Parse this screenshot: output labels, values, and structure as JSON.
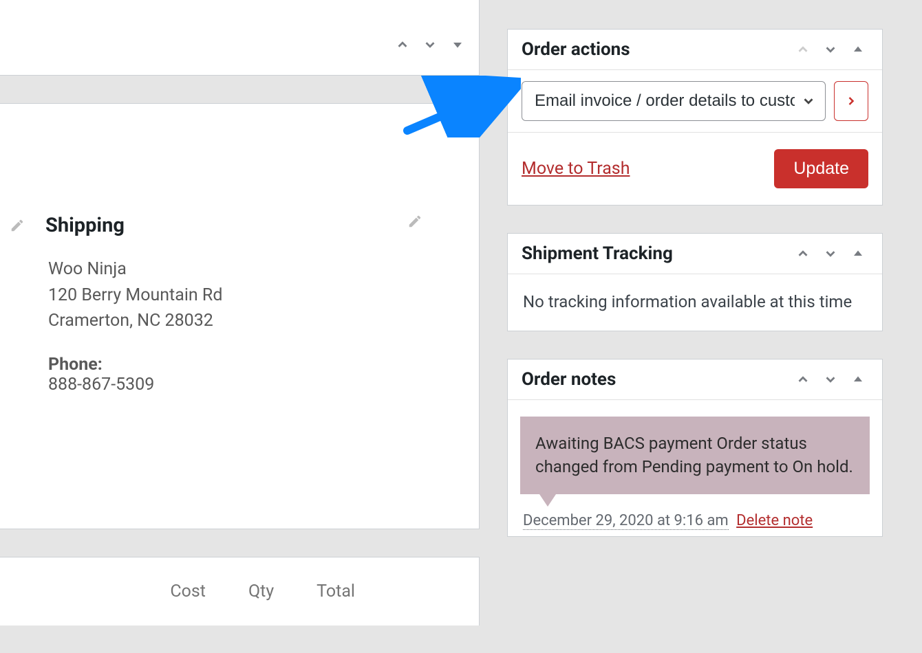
{
  "shipping": {
    "title": "Shipping",
    "name": "Woo Ninja",
    "address_line1": "120 Berry Mountain Rd",
    "address_line2": "Cramerton, NC 28032",
    "phone_label": "Phone:",
    "phone": "888-867-5309"
  },
  "itemsTable": {
    "col_cost": "Cost",
    "col_qty": "Qty",
    "col_total": "Total"
  },
  "orderActions": {
    "title": "Order actions",
    "select_value": "Email invoice / order details to customer",
    "trash": "Move to Trash",
    "update": "Update"
  },
  "shipmentTracking": {
    "title": "Shipment Tracking",
    "empty": "No tracking information available at this time"
  },
  "orderNotes": {
    "title": "Order notes",
    "note1": {
      "text": "Awaiting BACS payment Order status changed from Pending payment to On hold.",
      "timestamp": "December 29, 2020 at 9:16 am",
      "delete": "Delete note"
    }
  }
}
